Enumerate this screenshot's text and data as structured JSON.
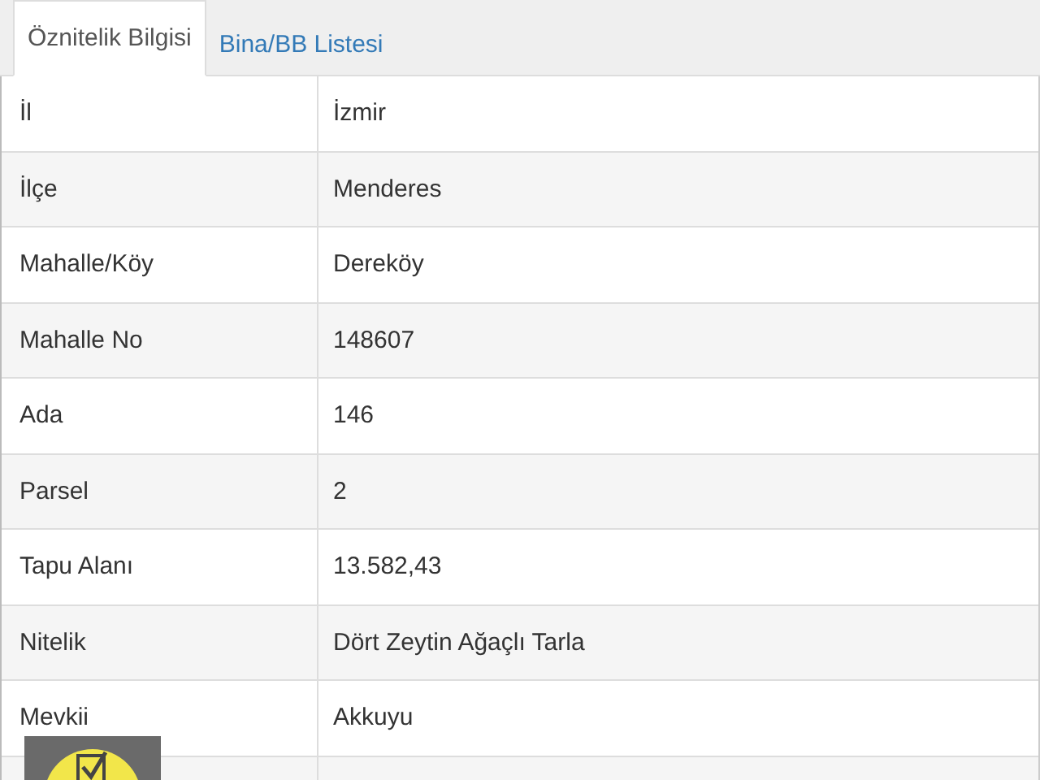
{
  "tabs": [
    {
      "label": "Öznitelik Bilgisi",
      "selected": true
    },
    {
      "label": "Bina/BB Listesi",
      "selected": false
    }
  ],
  "rows": [
    {
      "label": "İl",
      "value": "İzmir"
    },
    {
      "label": "İlçe",
      "value": "Menderes"
    },
    {
      "label": "Mahalle/Köy",
      "value": "Dereköy"
    },
    {
      "label": "Mahalle No",
      "value": "148607"
    },
    {
      "label": "Ada",
      "value": "146"
    },
    {
      "label": "Parsel",
      "value": "2"
    },
    {
      "label": "Tapu Alanı",
      "value": "13.582,43"
    },
    {
      "label": "Nitelik",
      "value": "Dört Zeytin Ağaçlı Tarla"
    },
    {
      "label": "Mevkii",
      "value": "Akkuyu"
    }
  ]
}
